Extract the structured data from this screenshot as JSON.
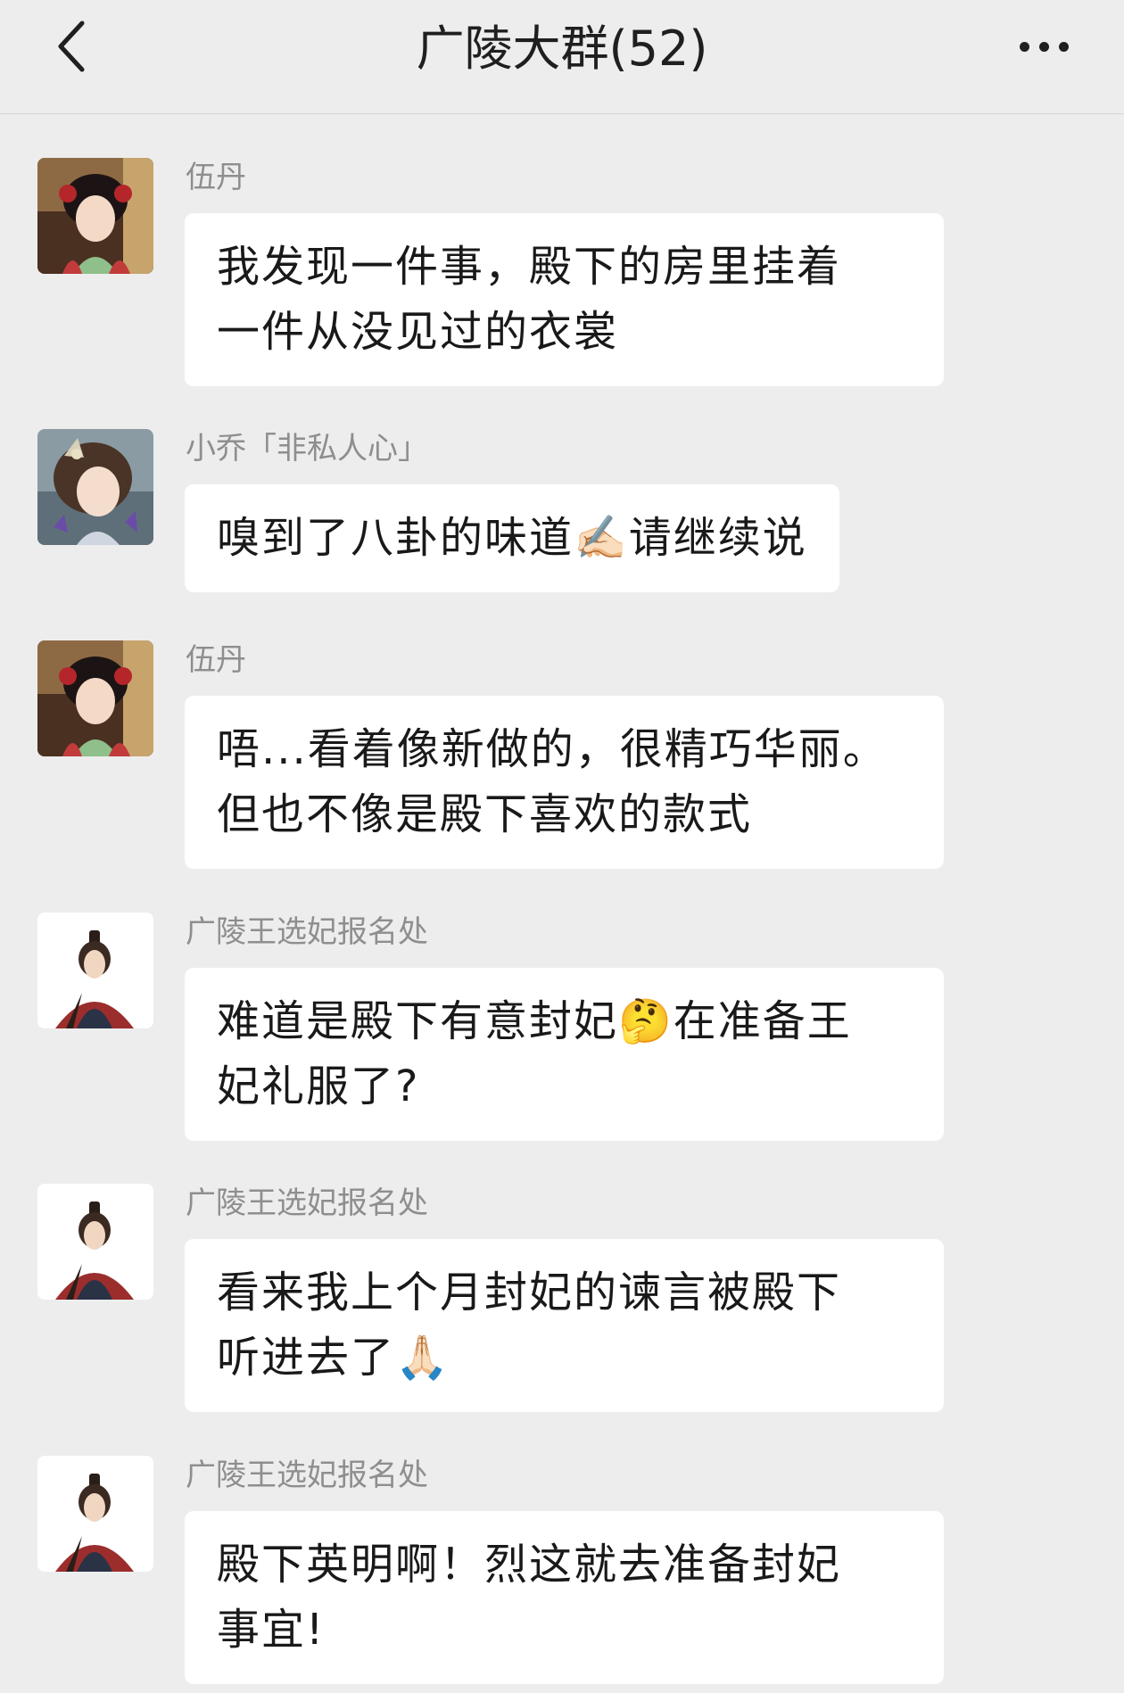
{
  "header": {
    "title": "广陵大群(52)"
  },
  "messages": [
    {
      "sender": "伍丹",
      "avatar": "wudan",
      "lines": [
        "我发现一件事，殿下的房里挂着",
        "一件从没见过的衣裳"
      ]
    },
    {
      "sender": "小乔「非私人心」",
      "avatar": "xiaoqiao",
      "lines": [
        "嗅到了八卦的味道✍🏻请继续说"
      ]
    },
    {
      "sender": "伍丹",
      "avatar": "wudan",
      "lines": [
        "唔...看着像新做的，很精巧华丽。",
        "但也不像是殿下喜欢的款式"
      ]
    },
    {
      "sender": "广陵王选妃报名处",
      "avatar": "lie",
      "lines": [
        "难道是殿下有意封妃🤔在准备王",
        "妃礼服了?"
      ]
    },
    {
      "sender": "广陵王选妃报名处",
      "avatar": "lie",
      "lines": [
        "看来我上个月封妃的谏言被殿下",
        "听进去了🙏🏻"
      ]
    },
    {
      "sender": "广陵王选妃报名处",
      "avatar": "lie",
      "lines": [
        "殿下英明啊！烈这就去准备封妃",
        "事宜!"
      ]
    }
  ]
}
